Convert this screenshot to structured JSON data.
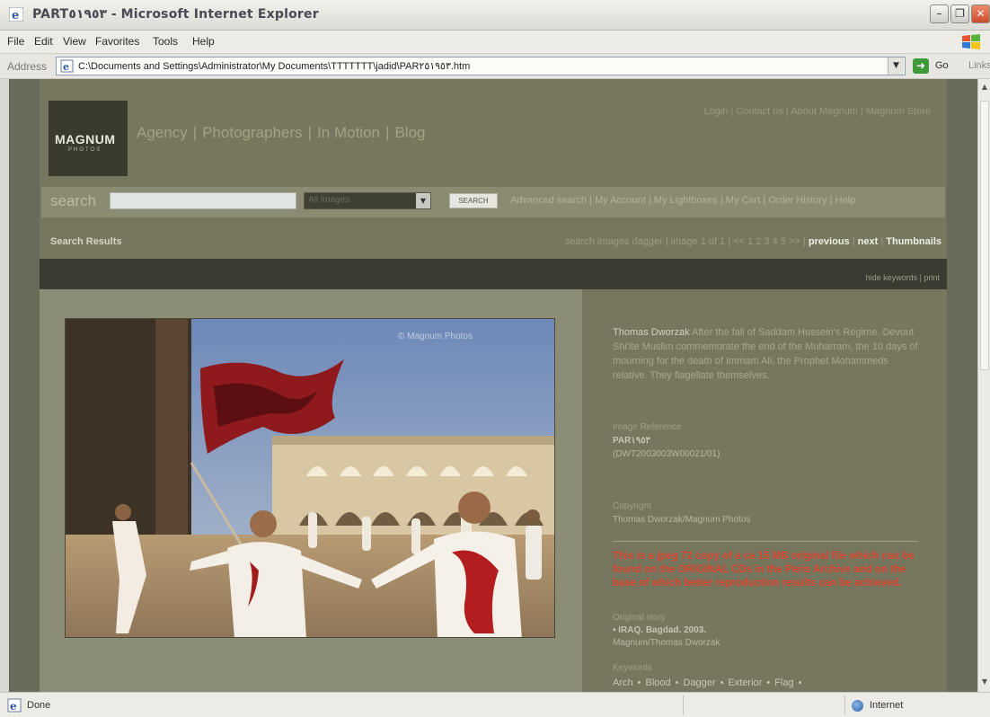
{
  "window": {
    "title": "PART٥١٩٥٣ - Microsoft Internet Explorer"
  },
  "menu": {
    "items": [
      "File",
      "Edit",
      "View",
      "Favorites",
      "Tools",
      "Help"
    ]
  },
  "address": {
    "label": "Address",
    "url": "C:\\Documents and Settings\\Administrator\\My Documents\\TTTTTTT\\jadid\\PAR٢٥١٩٥٣.htm",
    "go_label": "Go",
    "links_label": "Links"
  },
  "site": {
    "logo_name": "MAGNUM",
    "logo_sub": "PHOTOS",
    "nav": [
      "Agency",
      "Photographers",
      "In Motion",
      "Blog"
    ],
    "top_links": [
      "Login",
      "Contact us",
      "About Magnum",
      "Magnum Store"
    ],
    "search": {
      "label": "search",
      "select_value": "All images",
      "button": "SEARCH",
      "links": [
        "Advanced search",
        "My Account",
        "My Lightboxes",
        "My Cart",
        "Order History",
        "Help"
      ]
    },
    "results": {
      "title": "Search Results",
      "nav_text": "search images dagger | image 1 of 1 | << 1 2 3 4 5 >> |",
      "previous": "previous",
      "next": "next",
      "thumbnails": "Thumbnails"
    },
    "util_links": [
      "hide keywords",
      "print"
    ],
    "photo_watermark": "© Magnum Photos",
    "details": {
      "author": "Thomas Dworzak",
      "caption": "After the fall of Saddam Hussein's Regime. Devout Shi'ite Muslim commemorate the end of the Muharram, the 10 days of mourning for the death of Immam Ali, the Prophet Mohammeds relative. They flagellate themselves.",
      "image_reference_label": "Image Reference",
      "image_reference_value": "PAR١٩٥٣",
      "image_reference_sub": "(DWT2003003W00021/01)",
      "copyright_label": "Copyright",
      "copyright_value": "Thomas Dworzak/Magnum Photos",
      "note": "This is a jpeg 72 copy of a ca 15 MB original file which can be found on the ORIGINAL CDs in the Paris Archive and on the base of which better reproduction results can be achieved.",
      "original_story_label": "Original story",
      "original_story_value": "• IRAQ. Bagdad. 2003.",
      "original_story_credit": "Magnum/Thomas Dworzak",
      "keywords_label": "Keywords",
      "keywords": [
        "Arch",
        "Blood",
        "Dagger",
        "Exterior",
        "Flag"
      ]
    }
  },
  "status": {
    "text": "Done",
    "zone": "Internet"
  },
  "colors": {
    "page_bg": "#77775f",
    "note_red": "#d9432d",
    "dark_band": "#3b3b31"
  }
}
